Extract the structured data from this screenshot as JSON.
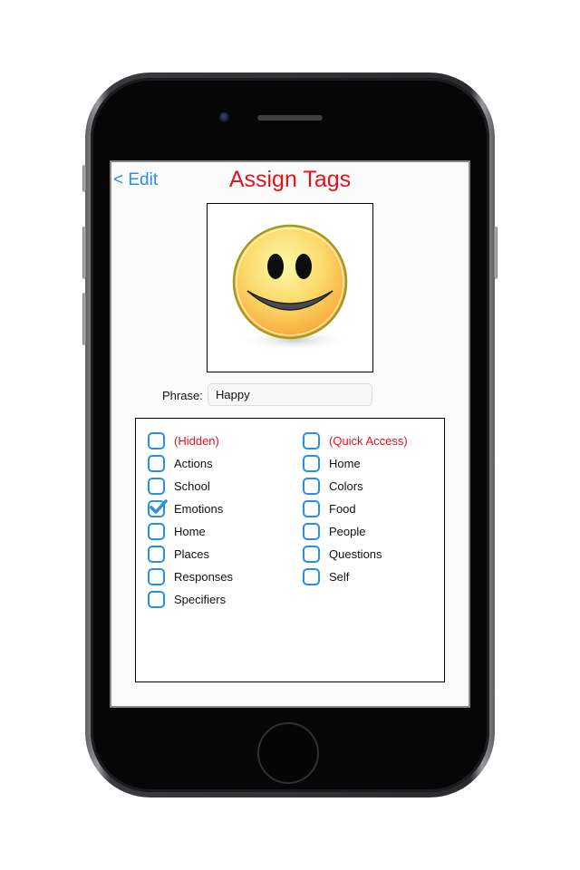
{
  "header": {
    "back_label": "< Edit",
    "title": "Assign Tags"
  },
  "image": {
    "icon": "smiley-face-icon",
    "description": "Yellow smiling face"
  },
  "phrase": {
    "label": "Phrase:",
    "value": "Happy"
  },
  "tags": {
    "left": [
      {
        "label": "(Hidden)",
        "checked": false,
        "special": true
      },
      {
        "label": "Actions",
        "checked": false,
        "special": false
      },
      {
        "label": "School",
        "checked": false,
        "special": false
      },
      {
        "label": "Emotions",
        "checked": true,
        "special": false
      },
      {
        "label": "Home",
        "checked": false,
        "special": false
      },
      {
        "label": "Places",
        "checked": false,
        "special": false
      },
      {
        "label": "Responses",
        "checked": false,
        "special": false
      },
      {
        "label": "Specifiers",
        "checked": false,
        "special": false
      }
    ],
    "right": [
      {
        "label": "(Quick Access)",
        "checked": false,
        "special": true
      },
      {
        "label": "Home",
        "checked": false,
        "special": false
      },
      {
        "label": "Colors",
        "checked": false,
        "special": false
      },
      {
        "label": "Food",
        "checked": false,
        "special": false
      },
      {
        "label": "People",
        "checked": false,
        "special": false
      },
      {
        "label": "Questions",
        "checked": false,
        "special": false
      },
      {
        "label": "Self",
        "checked": false,
        "special": false
      }
    ]
  },
  "colors": {
    "accent": "#2a8ee5",
    "title_red": "#e0141c"
  }
}
